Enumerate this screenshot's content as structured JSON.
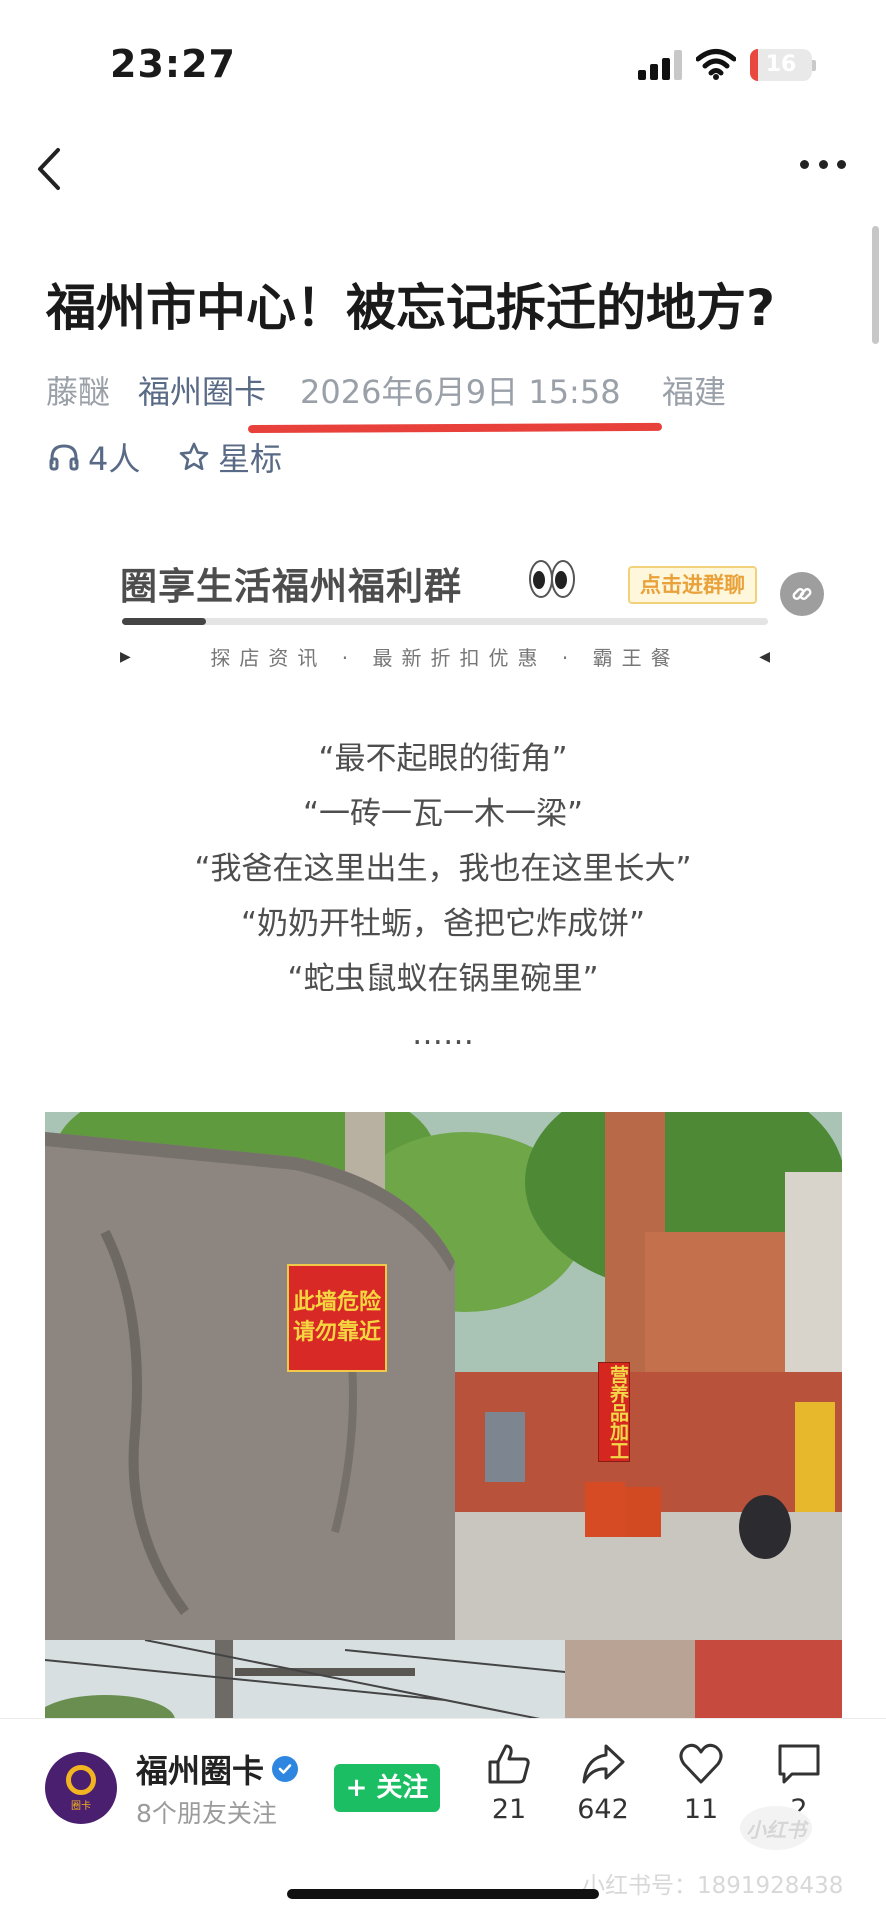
{
  "status_bar": {
    "time": "23:27",
    "battery": "16"
  },
  "article": {
    "title": "福州市中心！被忘记拆迁的地方?",
    "author": "藤醚",
    "account": "福州圈卡",
    "datetime": "2026年6月9日 15:58",
    "location": "福建",
    "listeners": "4人",
    "star_label": "星标"
  },
  "banner": {
    "title": "圈享生活福州福利群",
    "button": "点击进群聊",
    "subtitle": "探店资讯 · 最新折扣优惠 · 霸王餐",
    "progress": 0.13
  },
  "quotes": [
    "“最不起眼的街角”",
    "“一砖一瓦一木一梁”",
    "“我爸在这里出生，我也在这里长大”",
    "“奶奶开牡蛎，爸把它炸成饼”",
    "“蛇虫鼠蚁在锅里碗里”",
    "……"
  ],
  "photo": {
    "wall_sign_line1": "此墙危险",
    "wall_sign_line2": "请勿靠近",
    "shop_sign": "营养品加工"
  },
  "bottom_bar": {
    "account_name": "福州圈卡",
    "avatar_text": "圈卡",
    "friends_following": "8个朋友关注",
    "follow_button": "+ 关注",
    "likes": "21",
    "shares": "642",
    "favorites": "11",
    "comments": "2"
  },
  "watermark": {
    "text": "小红书号：1891928438",
    "logo": "小红书"
  },
  "colors": {
    "accent_red": "#e8413c",
    "follow_green": "#1bbe62",
    "link_blue": "#596a86"
  }
}
